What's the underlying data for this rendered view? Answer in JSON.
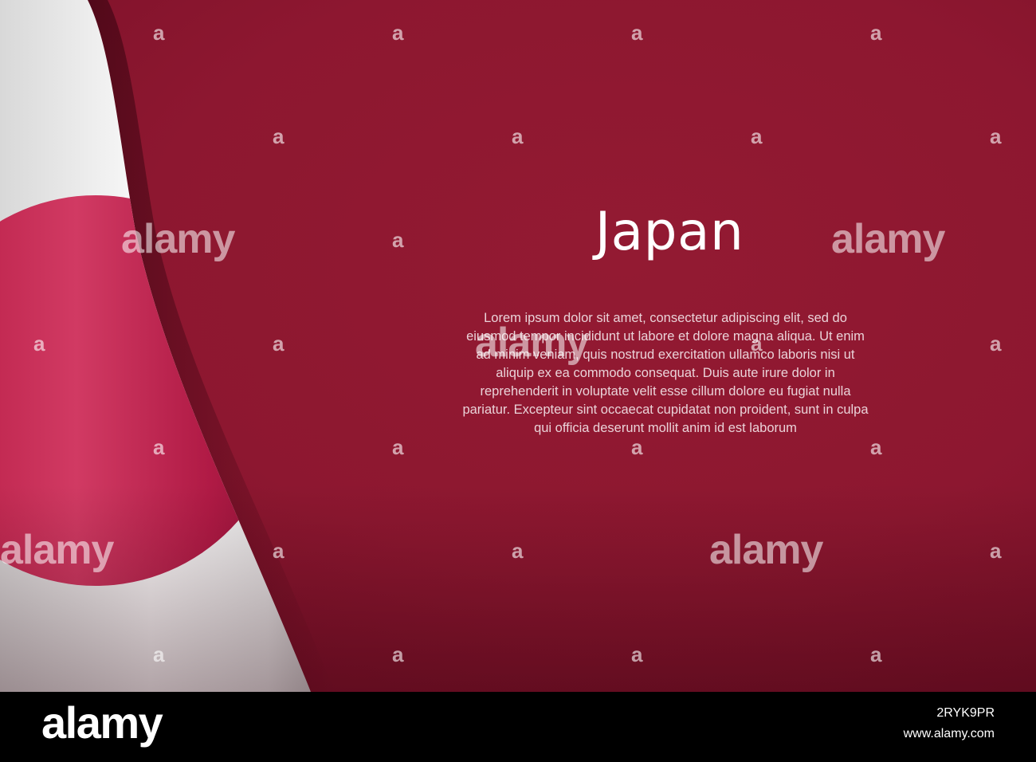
{
  "image": {
    "title": "Japan",
    "body_lines": [
      "Lorem ipsum dolor sit amet, consectetur adipiscing elit, sed do",
      "eiusmod tempor incididunt ut labore et dolore magna aliqua. Ut enim",
      "ad minim veniam, quis nostrud exercitation ullamco laboris nisi ut",
      "aliquip ex ea commodo consequat. Duis aute irure dolor in",
      "reprehenderit in voluptate velit esse cillum dolore eu fugiat nulla",
      "pariatur. Excepteur sint occaecat cupidatat non proident, sunt in culpa",
      "qui officia deserunt mollit anim id est laborum"
    ],
    "watermark": "alamy",
    "flag_icon": "japan-flag-icon",
    "colors": {
      "background": "#8d1730",
      "flag_white": "#f2f2f2",
      "flag_red": "#bf1e4b",
      "footer": "#000000"
    }
  },
  "footer": {
    "logo": "alamy",
    "image_id": "2RYK9PR",
    "url": "www.alamy.com"
  }
}
